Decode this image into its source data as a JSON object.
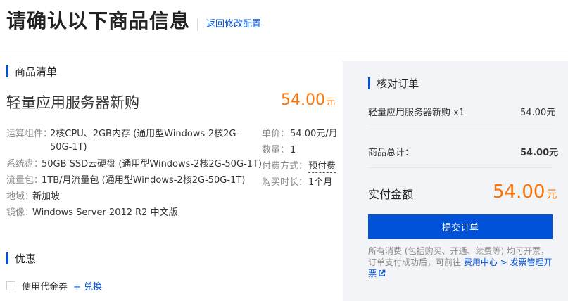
{
  "header": {
    "title": "请确认以下商品信息",
    "back_link": "返回修改配置"
  },
  "list": {
    "heading": "商品清单",
    "product_name": "轻量应用服务器新购",
    "price": "54.00",
    "price_unit": "元",
    "specs": [
      {
        "key": "运算组件：",
        "value": "2核CPU、2GB内存 (通用型Windows-2核2G-50G-1T)"
      },
      {
        "key": "系统盘：",
        "value": "50GB SSD云硬盘 (通用型Windows-2核2G-50G-1T)"
      },
      {
        "key": "流量包：",
        "value": "1TB/月流量包 (通用型Windows-2核2G-50G-1T)"
      },
      {
        "key": "地域：",
        "value": "新加坡"
      },
      {
        "key": "镜像：",
        "value": "Windows Server 2012 R2 中文版"
      }
    ],
    "meta": [
      {
        "key": "单价：",
        "value": "54.00元/月"
      },
      {
        "key": "数量：",
        "value": "1"
      },
      {
        "key": "付费方式：",
        "value": "预付费"
      },
      {
        "key": "购买时长：",
        "value": "1个月"
      }
    ]
  },
  "discount": {
    "heading": "优惠",
    "coupon_label": "使用代金券",
    "redeem_link": "+ 兑换"
  },
  "summary": {
    "heading": "核对订单",
    "item_label": "轻量应用服务器新购 x1",
    "item_price": "54.00元",
    "total_label": "商品总计：",
    "total_value": "54.00元",
    "pay_label": "实付金额",
    "pay_amount": "54.00",
    "pay_unit": "元",
    "submit_label": "提交订单",
    "note_text": "所有消费 (包括购买、开通、续费等) 均可开票，订单支付成功后，可前往 ",
    "note_link": "费用中心 > 发票管理开票"
  },
  "colors": {
    "accent": "#0052d9",
    "price": "#ff7200"
  }
}
